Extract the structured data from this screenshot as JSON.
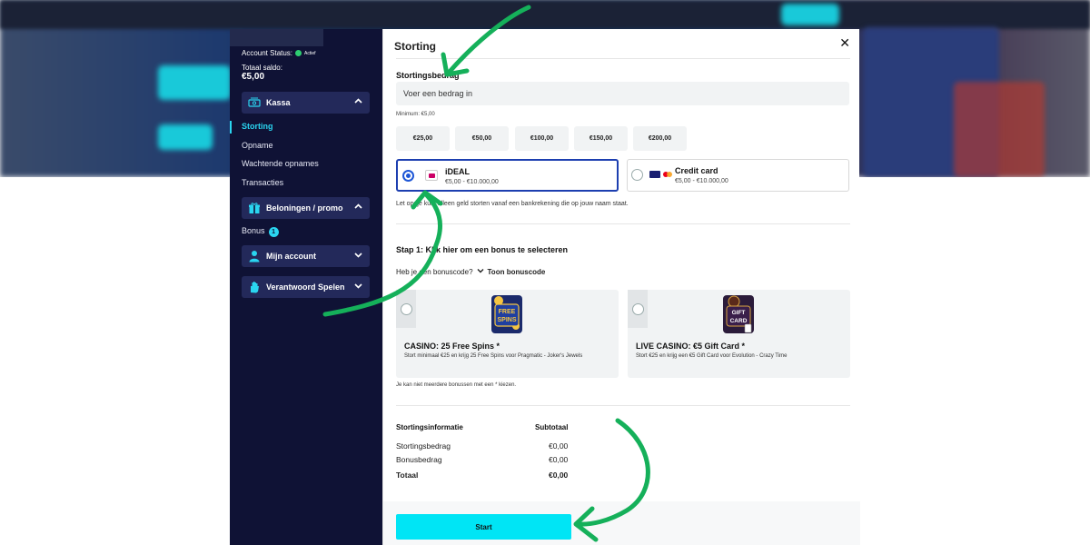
{
  "colors": {
    "sidebar_bg": "#0f1235",
    "accent_cyan": "#00e5f5",
    "active_link": "#2ad5f0",
    "selected_border": "#1d3fb0",
    "arrow_green": "#15b05a"
  },
  "sidebar": {
    "account_status_label": "Account Status:",
    "account_status_value": "Actief",
    "balance_label": "Totaal saldo:",
    "balance_value": "€5,00",
    "sections": [
      {
        "label": "Kassa",
        "icon": "cash-register-icon",
        "expanded": true
      },
      {
        "label": "Beloningen / promo",
        "icon": "gift-icon",
        "expanded": true
      },
      {
        "label": "Mijn account",
        "icon": "user-icon",
        "expanded": false
      },
      {
        "label": "Verantwoord Spelen",
        "icon": "hand-icon",
        "expanded": false
      }
    ],
    "kassa_items": [
      "Storting",
      "Opname",
      "Wachtende opnames",
      "Transacties"
    ],
    "promo_items": [
      {
        "label": "Bonus",
        "badge": "1"
      }
    ]
  },
  "modal": {
    "title": "Storting",
    "close_icon": "✕",
    "amount_label": "Stortingsbedrag",
    "amount_placeholder": "Voer een bedrag in",
    "minimum": "Minimum: €5,00",
    "presets": [
      "€25,00",
      "€50,00",
      "€100,00",
      "€150,00",
      "€200,00"
    ],
    "payment_methods": [
      {
        "name": "iDEAL",
        "range": "€5,00 - €10.000,00",
        "selected": true
      },
      {
        "name": "Credit card",
        "range": "€5,00 - €10.000,00",
        "selected": false
      }
    ],
    "note": "Let op: je kunt alleen geld storten vanaf een bankrekening die op jouw naam staat.",
    "step1_title": "Stap 1: Klik hier om een bonus te selecteren",
    "bonus_code_question": "Heb je een bonuscode?",
    "bonus_code_toggle": "Toon bonuscode",
    "bonuses": [
      {
        "title": "CASINO: 25 Free Spins",
        "asterisk": "*",
        "desc": "Stort minimaal €25 en krijg 25 Free Spins voor Pragmatic - Joker's Jewels",
        "image_text_1": "FREE",
        "image_text_2": "SPINS"
      },
      {
        "title": "LIVE CASINO: €5 Gift Card",
        "asterisk": "*",
        "desc": "Stort €25 en krijg een €5 Gift Card voor Evolution - Crazy Time",
        "image_text_1": "GIFT",
        "image_text_2": "CARD"
      }
    ],
    "bonus_note": "Je kan niet meerdere bonussen met een * kiezen.",
    "info": {
      "header_left": "Stortingsinformatie",
      "header_right": "Subtotaal",
      "rows": [
        {
          "label": "Stortingsbedrag",
          "value": "€0,00"
        },
        {
          "label": "Bonusbedrag",
          "value": "€0,00"
        },
        {
          "label": "Totaal",
          "value": "€0,00"
        }
      ]
    },
    "submit_label": "Start"
  }
}
